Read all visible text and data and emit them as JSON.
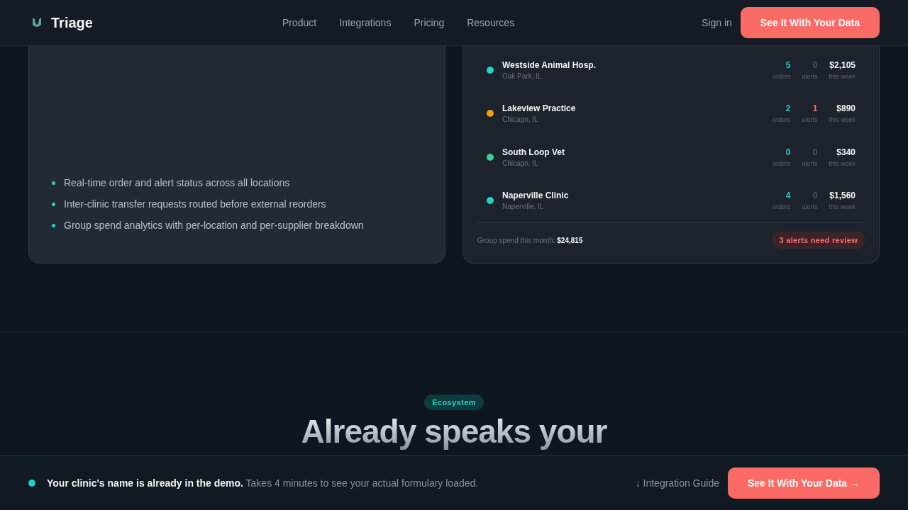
{
  "nav": {
    "brand": "Triage",
    "links": [
      "Product",
      "Integrations",
      "Pricing",
      "Resources"
    ],
    "sign_in": "Sign in",
    "cta": "See It With Your Data"
  },
  "features": [
    "Real-time order and alert status across all locations",
    "Inter-clinic transfer requests routed before external reorders",
    "Group spend analytics with per-location and per-supplier breakdown"
  ],
  "locations": [
    {
      "name": "Westside Animal Hosp.",
      "city": "Oak Park, IL",
      "color": "#22d3c5",
      "orders": "5",
      "orders_label": "orders",
      "alerts": "0",
      "alerts_label": "alerts",
      "alerts_flagged": false,
      "spend": "$2,105",
      "spend_label": "this week"
    },
    {
      "name": "Lakeview Practice",
      "city": "Chicago, IL",
      "color": "#f59e0b",
      "orders": "2",
      "orders_label": "orders",
      "alerts": "1",
      "alerts_label": "alerts",
      "alerts_flagged": true,
      "spend": "$890",
      "spend_label": "this week"
    },
    {
      "name": "South Loop Vet",
      "city": "Chicago, IL",
      "color": "#34d399",
      "orders": "0",
      "orders_label": "orders",
      "alerts": "0",
      "alerts_label": "alerts",
      "alerts_flagged": false,
      "spend": "$340",
      "spend_label": "this week"
    },
    {
      "name": "Naperville Clinic",
      "city": "Naperville, IL",
      "color": "#22d3c5",
      "orders": "4",
      "orders_label": "orders",
      "alerts": "0",
      "alerts_label": "alerts",
      "alerts_flagged": false,
      "spend": "$1,560",
      "spend_label": "this week"
    }
  ],
  "summary": {
    "text": "Group spend this month: **$24,815**",
    "badge": "3 alerts need review"
  },
  "ecosystem": {
    "badge": "Ecosystem",
    "heading": "Already speaks your"
  },
  "banner": {
    "text": "**Your clinic's name is already in the demo.** Takes 4 minutes to see your actual formulary loaded.",
    "guide_link": "↓ Integration Guide",
    "cta": "See It With Your Data →"
  }
}
